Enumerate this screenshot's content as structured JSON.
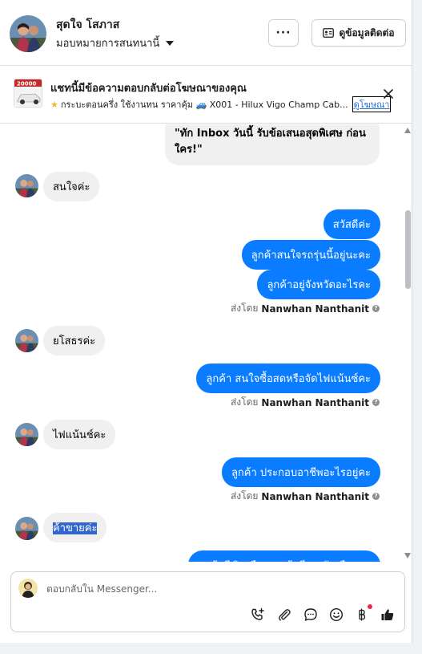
{
  "header": {
    "contact_name": "สุดใจ โสภาส",
    "status_label": "มอบหมายการสนทนานี้",
    "more_label": "···",
    "contact_info_label": "ดูข้อมูลติดต่อ"
  },
  "ad_banner": {
    "title": "แชทนี้มีข้อความตอบกลับต่อโฆษณาของคุณ",
    "description": "กระบะตอนครึ่ง ใช้งานทน ราคาคุ้ม 🚙 X001 - Hilux Vigo Champ Cab...",
    "link_label": "ดูโฆษณา",
    "thumb_price": "20000"
  },
  "messages": {
    "ad_reply": "\"ทัก Inbox วันนี้ รับข้อเสนอสุดพิเศษ ก่อนใคร!\"",
    "in_1": "สนใจค่ะ",
    "out_1": "สวัสดีค่ะ",
    "out_2": "ลูกค้าสนใจรถรุ่นนี้อยู่นะคะ",
    "out_3": "ลูกค้าอยู่จังหวัดอะไรคะ",
    "in_2": "ยโสธรค่ะ",
    "out_4": "ลูกค้า สนใจซื้อสดหรือจัดไฟแน้นซ์คะ",
    "in_3": "ไฟแน้นช์คะ",
    "out_5": "ลูกค้า ประกอบอาชีพอะไรอยู่คะ",
    "in_4": "ค้าขายค่ะ",
    "out_6_partial": "ลูกค้ามีเงินเดือน ลูกค้ามีรายรับเดือนละ"
  },
  "sent_by": {
    "prefix": "ส่งโดย",
    "name": "Nanwhan Nanthanit"
  },
  "composer": {
    "placeholder": "ตอบกลับใน Messenger..."
  },
  "icons": {
    "header_more": "more-icon",
    "contact_card": "contact-card-icon",
    "close": "close-icon",
    "call_add": "phone-add-icon",
    "attach": "paperclip-icon",
    "saved_replies": "chat-bubble-icon",
    "emoji": "emoji-icon",
    "payment": "baht-icon",
    "like": "thumbs-up-icon"
  },
  "colors": {
    "outgoing_bubble": "#0a7cff",
    "incoming_bubble": "#f0f0f0",
    "link": "#216fdb",
    "notification_dot": "#f02849"
  }
}
